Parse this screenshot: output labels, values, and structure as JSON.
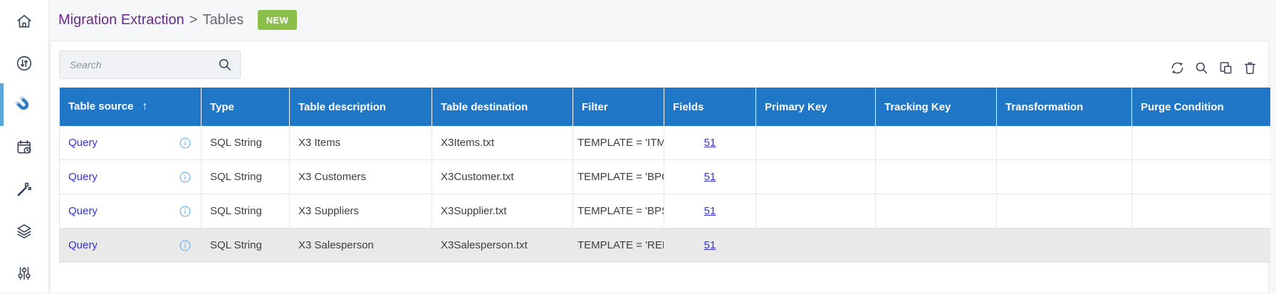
{
  "breadcrumb": {
    "primary": "Migration Extraction",
    "separator": ">",
    "secondary": "Tables"
  },
  "actions": {
    "new_label": "NEW"
  },
  "search": {
    "placeholder": "Search"
  },
  "sidebar": {
    "items": [
      {
        "icon": "home-icon",
        "active": false
      },
      {
        "icon": "sync-arrows-icon",
        "active": false
      },
      {
        "icon": "magnet-icon",
        "active": true
      },
      {
        "icon": "schedule-calendar-icon",
        "active": false
      },
      {
        "icon": "magic-wand-icon",
        "active": false
      },
      {
        "icon": "layers-icon",
        "active": false
      },
      {
        "icon": "sliders-icon",
        "active": false
      }
    ]
  },
  "toolbar": {
    "icons": [
      "refresh-icon",
      "search-icon",
      "duplicate-icon",
      "delete-icon"
    ]
  },
  "table": {
    "sorted_column": "Table source",
    "sort_direction": "ascending",
    "sort_arrow": "↑",
    "columns": [
      {
        "label": "Table source"
      },
      {
        "label": "Type"
      },
      {
        "label": "Table description"
      },
      {
        "label": "Table destination"
      },
      {
        "label": "Filter"
      },
      {
        "label": "Fields"
      },
      {
        "label": "Primary Key"
      },
      {
        "label": "Tracking Key"
      },
      {
        "label": "Transformation"
      },
      {
        "label": "Purge Condition"
      }
    ],
    "rows": [
      {
        "source": "Query",
        "type": "SQL String",
        "description": "X3 Items",
        "destination": "X3Items.txt",
        "filter": "TEMPLATE = 'ITMDS'",
        "fields": "51",
        "primary_key": "",
        "tracking_key": "",
        "transformation": "",
        "purge_condition": "",
        "selected": false
      },
      {
        "source": "Query",
        "type": "SQL String",
        "description": "X3 Customers",
        "destination": "X3Customer.txt",
        "filter": "TEMPLATE = 'BPCDS'",
        "fields": "51",
        "primary_key": "",
        "tracking_key": "",
        "transformation": "",
        "purge_condition": "",
        "selected": false
      },
      {
        "source": "Query",
        "type": "SQL String",
        "description": "X3 Suppliers",
        "destination": "X3Supplier.txt",
        "filter": "TEMPLATE = 'BPSDS'",
        "fields": "51",
        "primary_key": "",
        "tracking_key": "",
        "transformation": "",
        "purge_condition": "",
        "selected": false
      },
      {
        "source": "Query",
        "type": "SQL String",
        "description": "X3 Salesperson",
        "destination": "X3Salesperson.txt",
        "filter": "TEMPLATE = 'REPDS'",
        "fields": "51",
        "primary_key": "",
        "tracking_key": "",
        "transformation": "",
        "purge_condition": "",
        "selected": true
      }
    ]
  },
  "colors": {
    "header_blue": "#2077c8",
    "link_blue": "#3431d2",
    "accent_green": "#8cbf4a",
    "breadcrumb_purple": "#692a8f",
    "active_indicator_blue": "#58a6dc",
    "selected_row_bg": "#e9e9e9",
    "info_icon_blue": "#6fb2ef"
  }
}
